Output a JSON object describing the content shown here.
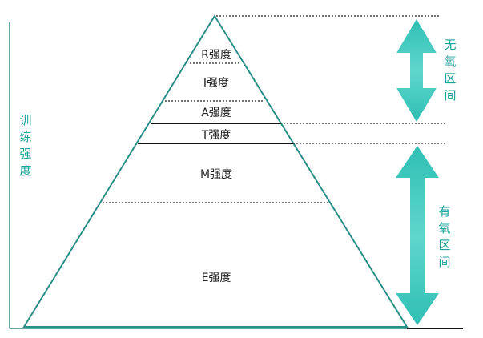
{
  "y_axis_label": "训练强度",
  "levels": [
    {
      "id": "R",
      "label": "R强度"
    },
    {
      "id": "I",
      "label": "I强度"
    },
    {
      "id": "A",
      "label": "A强度"
    },
    {
      "id": "T",
      "label": "T强度"
    },
    {
      "id": "M",
      "label": "M强度"
    },
    {
      "id": "E",
      "label": "E强度"
    }
  ],
  "zones": {
    "anaerobic": {
      "label": "无氧区间"
    },
    "aerobic": {
      "label": "有氧区间"
    }
  },
  "colors": {
    "pyramid_outline": "#2a8f86",
    "arrow_fill": "#3fc9be",
    "text_accent": "#1ba39a",
    "divider": "#111111"
  }
}
